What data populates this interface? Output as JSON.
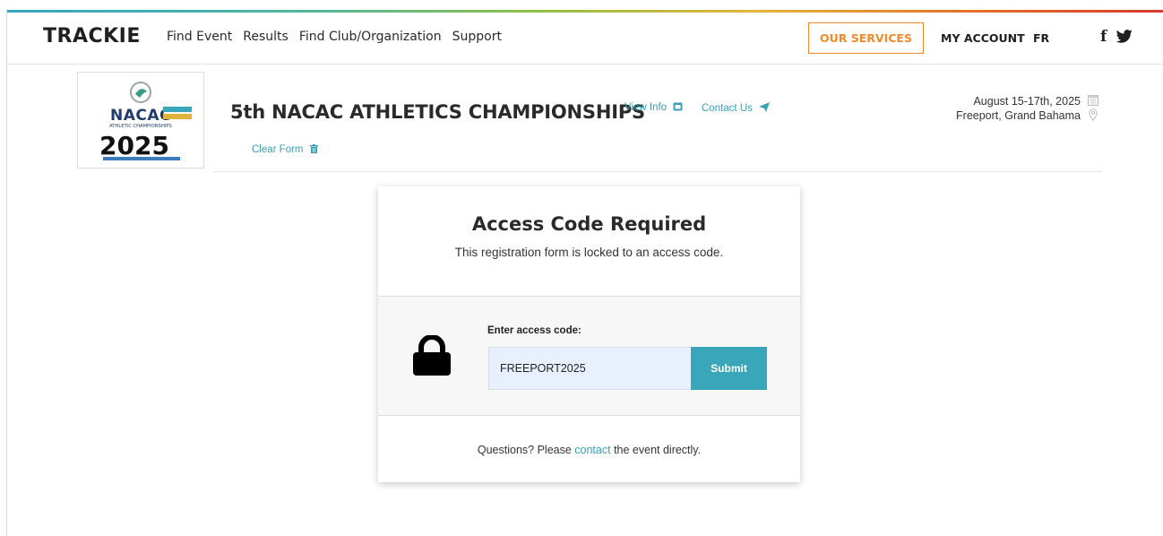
{
  "nav": {
    "logo": "TRACKIE",
    "links": [
      "Find Event",
      "Results",
      "Find Club/Organization",
      "Support"
    ],
    "services_label": "OUR SERVICES",
    "account_label": "MY ACCOUNT",
    "lang_label": "FR",
    "facebook_glyph": "f",
    "icons": [
      "facebook-icon",
      "twitter-icon"
    ]
  },
  "event": {
    "title": "5th NACAC ATHLETICS CHAMPIONSHIPS",
    "view_info": "View Info",
    "contact_us": "Contact Us",
    "clear_form": "Clear Form",
    "date": "August 15-17th, 2025",
    "location": "Freeport, Grand Bahama",
    "logo": {
      "word": "NACAC",
      "sub": "ATHLETIC CHAMPIONSHIPS",
      "year": "2025"
    }
  },
  "card": {
    "title": "Access Code Required",
    "subtitle": "This registration form is locked to an access code.",
    "label": "Enter access code:",
    "input_value": "FREEPORT2025",
    "submit_label": "Submit",
    "footer_before": "Questions? Please ",
    "footer_link": "contact",
    "footer_after": " the event directly."
  },
  "colors": {
    "accent": "#3aa6b9",
    "services_orange": "#f08a2a",
    "input_bg": "#e8f0fe"
  }
}
